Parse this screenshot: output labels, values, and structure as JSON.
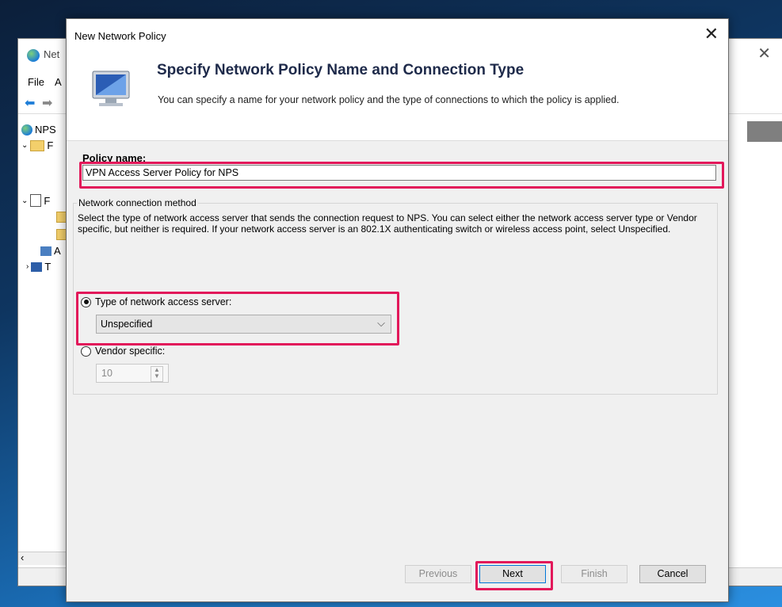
{
  "background_window": {
    "title": "Net",
    "menu": [
      "File",
      "A"
    ],
    "tree": [
      {
        "label": "NPS"
      },
      {
        "label": "F"
      },
      {
        "label": "F"
      },
      {
        "label": "A"
      },
      {
        "label": "T"
      }
    ]
  },
  "dialog": {
    "title": "New Network Policy",
    "header": {
      "title": "Specify Network Policy Name and Connection Type",
      "subtitle": "You can specify a name for your network policy and the type of connections to which the policy is applied."
    },
    "policy_name": {
      "label": "Policy name:",
      "value": "VPN Access Server Policy for NPS"
    },
    "connection_method": {
      "legend": "Network connection method",
      "description": "Select the type of network access server that sends the connection request to NPS. You can select either the network access server type or Vendor specific, but neither is required.  If your network access server is an 802.1X authenticating switch or wireless access point, select Unspecified.",
      "type_radio_label": "Type of network access server:",
      "type_selected": true,
      "type_value": "Unspecified",
      "vendor_radio_label": "Vendor specific:",
      "vendor_selected": false,
      "vendor_value": "10"
    },
    "buttons": {
      "previous": "Previous",
      "next": "Next",
      "finish": "Finish",
      "cancel": "Cancel"
    }
  },
  "colors": {
    "highlight": "#e2185a",
    "header_title": "#1e2a4a"
  }
}
